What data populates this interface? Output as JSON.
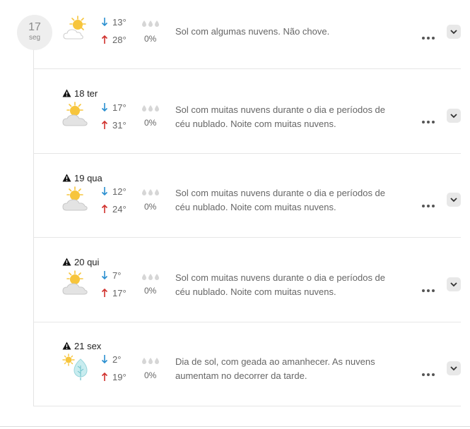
{
  "today": {
    "day_number": "17",
    "day_abbr": "seg"
  },
  "days": [
    {
      "date_label": "",
      "warning": false,
      "icon": "sun-cloud-icon",
      "temp_min": "13°",
      "temp_max": "28°",
      "rain": "0%",
      "description_line1": "Sol com algumas nuvens. Não chove.",
      "description_line2": ""
    },
    {
      "date_label": "18 ter",
      "warning": true,
      "icon": "sun-cloud-icon",
      "temp_min": "17°",
      "temp_max": "31°",
      "rain": "0%",
      "description_line1": "Sol com muitas nuvens durante o dia e períodos de",
      "description_line2": "céu nublado. Noite com muitas nuvens."
    },
    {
      "date_label": "19 qua",
      "warning": true,
      "icon": "sun-cloud-icon",
      "temp_min": "12°",
      "temp_max": "24°",
      "rain": "0%",
      "description_line1": "Sol com muitas nuvens durante o dia e períodos de",
      "description_line2": "céu nublado. Noite com muitas nuvens."
    },
    {
      "date_label": "20 qui",
      "warning": true,
      "icon": "sun-cloud-icon",
      "temp_min": "7°",
      "temp_max": "17°",
      "rain": "0%",
      "description_line1": "Sol com muitas nuvens durante o dia e períodos de",
      "description_line2": "céu nublado. Noite com muitas nuvens."
    },
    {
      "date_label": "21 sex",
      "warning": true,
      "icon": "sun-frost-icon",
      "temp_min": "2°",
      "temp_max": "19°",
      "rain": "0%",
      "description_line1": "Dia de sol, com geada ao amanhecer. As nuvens",
      "description_line2": "aumentam no decorrer da tarde."
    }
  ],
  "colors": {
    "arrow_down": "#2a8fd0",
    "arrow_up": "#d0312d",
    "sun": "#f7c53c",
    "cloud": "#e3e3e3",
    "frost": "#c8ecef"
  }
}
